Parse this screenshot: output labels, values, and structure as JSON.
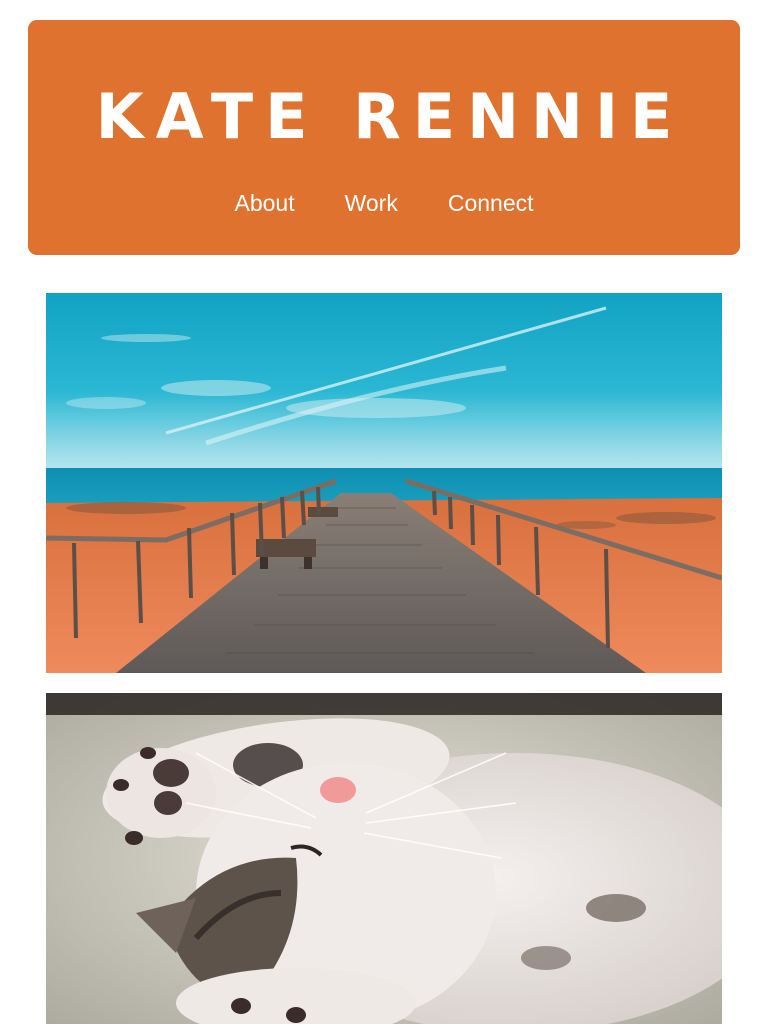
{
  "header": {
    "title": "KATE RENNIE",
    "background_color": "#e0722f"
  },
  "nav": {
    "items": [
      {
        "label": "About"
      },
      {
        "label": "Work"
      },
      {
        "label": "Connect"
      }
    ]
  },
  "gallery": {
    "photos": [
      {
        "subject": "boardwalk-to-sea"
      },
      {
        "subject": "sleeping-kitten"
      }
    ]
  }
}
